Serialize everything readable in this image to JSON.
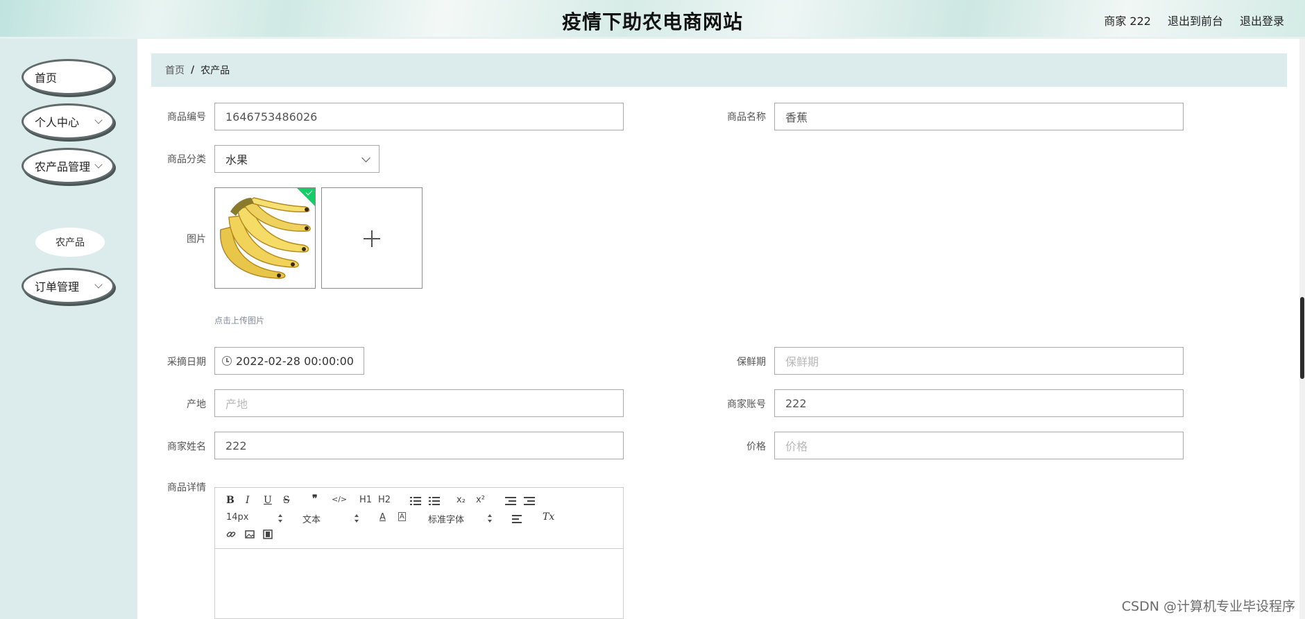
{
  "header": {
    "title": "疫情下助农电商网站",
    "user": "商家 222",
    "back_to_front": "退出到前台",
    "logout": "退出登录"
  },
  "sidebar": {
    "items": [
      {
        "label": "首页"
      },
      {
        "label": "个人中心"
      },
      {
        "label": "农产品管理"
      },
      {
        "label": "订单管理"
      }
    ],
    "sub_item": "农产品"
  },
  "breadcrumb": {
    "home": "首页",
    "separator": "/",
    "current": "农产品"
  },
  "form": {
    "product_no": {
      "label": "商品编号",
      "value": "1646753486026"
    },
    "product_name": {
      "label": "商品名称",
      "value": "香蕉"
    },
    "category": {
      "label": "商品分类",
      "value": "水果"
    },
    "image": {
      "label": "图片",
      "tip": "点击上传图片",
      "uploaded": "banana"
    },
    "pick_date": {
      "label": "采摘日期",
      "value": "2022-02-28 00:00:00"
    },
    "shelf_life": {
      "label": "保鲜期",
      "placeholder": "保鲜期"
    },
    "origin": {
      "label": "产地",
      "placeholder": "产地"
    },
    "merchant_account": {
      "label": "商家账号",
      "value": "222"
    },
    "merchant_name": {
      "label": "商家姓名",
      "value": "222"
    },
    "price": {
      "label": "价格",
      "placeholder": "价格"
    },
    "details": {
      "label": "商品详情"
    }
  },
  "editor": {
    "bold": "B",
    "italic": "I",
    "underline": "U",
    "strike": "S",
    "quote": "❞",
    "code": "</>",
    "h1": "H1",
    "h2": "H2",
    "sub": "x₂",
    "sup": "x²",
    "font_size": "14px",
    "text_type": "文本",
    "font_family": "标准字体",
    "clear": "Tx"
  },
  "watermark": "CSDN @计算机专业毕设程序",
  "colors": {
    "sidebar_bg": "#dcebeb",
    "success_green": "#13ce66"
  }
}
